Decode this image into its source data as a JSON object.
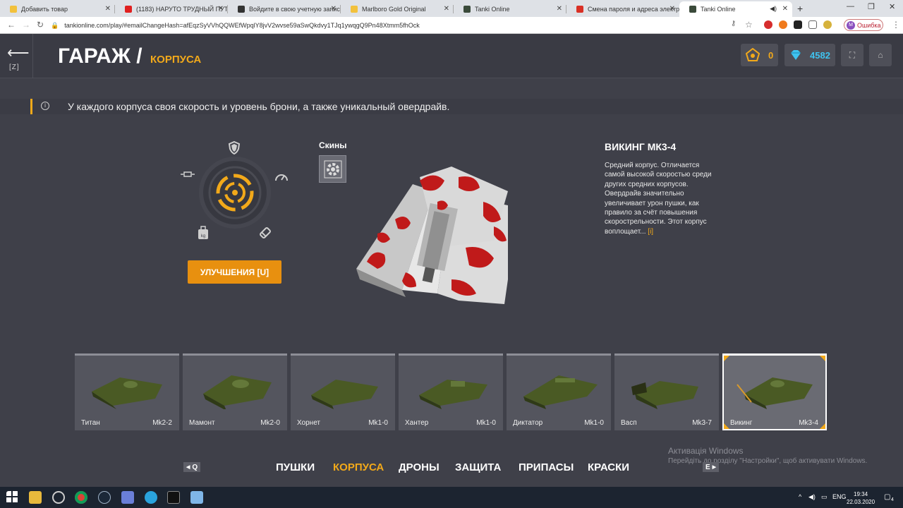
{
  "browser": {
    "tabs": [
      {
        "title": "Добавить товар",
        "color": "#f2c13c"
      },
      {
        "title": "(1183) НАРУТО ТРУДНЫЙ ПУТЬ",
        "color": "#e02020"
      },
      {
        "title": "Войдите в свою учетную запись",
        "color": "#333333"
      },
      {
        "title": "Marlboro Gold Original",
        "color": "#f2c13c"
      },
      {
        "title": "Tanki Online",
        "color": "#3a4a3a"
      },
      {
        "title": "Смена пароля и адреса электр",
        "color": "#d93025"
      },
      {
        "title": "Tanki Online",
        "color": "#3a4a3a"
      }
    ],
    "new_tab": "+",
    "url": "tankionline.com/play/#emailChangeHash=afEqzSyVVhQQWEfWpqlY8jvV2wvse59aSwQkdvy1TJq1ywqgQ9Pn48Xtmm5fhOck",
    "profile_initial": "M",
    "error_label": "Ошибка"
  },
  "game": {
    "back_key": "[Z]",
    "title": "ГАРАЖ /",
    "subtitle": "КОРПУСА",
    "stars": "0",
    "crystals": "4582",
    "info_text": "У каждого корпуса своя скорость и уровень брони, а также уникальный овердрайв.",
    "upgrades_button": "УЛУЧШЕНИЯ [U]",
    "skins_label": "Скины",
    "hull_name": "ВИКИНГ МК3-4",
    "hull_description": "Средний корпус. Отличается самой высокой скоростью среди других средних корпусов. Овердрайв значительно увеличивает урон пушки, как правило за счёт повышения скорострельности. Этот корпус воплощает...",
    "hull_more": "[i]",
    "colors": {
      "accent": "#f2a91a",
      "button": "#e8900f",
      "crystal": "#3fc3ef"
    },
    "hulls": [
      {
        "name": "Титан",
        "mk": "Mk2-2"
      },
      {
        "name": "Мамонт",
        "mk": "Mk2-0"
      },
      {
        "name": "Хорнет",
        "mk": "Mk1-0"
      },
      {
        "name": "Хантер",
        "mk": "Mk1-0"
      },
      {
        "name": "Диктатор",
        "mk": "Mk1-0"
      },
      {
        "name": "Васп",
        "mk": "Mk3-7"
      },
      {
        "name": "Викинг",
        "mk": "Mk3-4",
        "selected": true
      }
    ],
    "nav_prev_key": "Q",
    "nav_next_key": "E",
    "nav_items": [
      {
        "label": "ПУШКИ"
      },
      {
        "label": "КОРПУСА",
        "active": true
      },
      {
        "label": "ДРОНЫ"
      },
      {
        "label": "ЗАЩИТА"
      },
      {
        "label": "ПРИПАСЫ"
      },
      {
        "label": "КРАСКИ"
      }
    ],
    "windows_activation_title": "Активація Windows",
    "windows_activation_text": "Перейдіть до розділу \"Настройки\", щоб активувати Windows."
  },
  "taskbar": {
    "language": "ENG",
    "time": "19:34",
    "date": "22.03.2020",
    "notifications": "4"
  }
}
